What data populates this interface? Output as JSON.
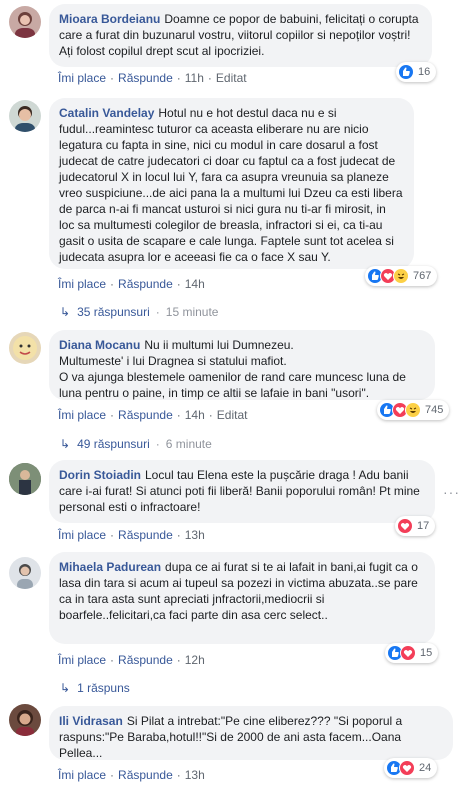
{
  "actions": {
    "like": "Îmi place",
    "reply": "Răspunde",
    "edited": "Editat",
    "dot": "·"
  },
  "comments": [
    {
      "author": "Mioara Bordeianu",
      "text": "Doamne ce popor de babuini, felicitați o corupta care a furat din buzunarul vostru, viitorul copiilor si nepoților voștri! Ați folost copilul drept scut al ipocriziei.",
      "time": "11h",
      "reactions": "16",
      "reaction_types": [
        "like"
      ]
    },
    {
      "author": "Catalin Vandelay",
      "text": "Hotul nu e hot destul daca nu e si fudul...reamintesc tuturor ca aceasta eliberare nu are nicio legatura cu fapta in sine, nici cu modul in care dosarul a fost judecat de catre judecatori ci doar cu faptul ca a fost judecat de judecatorul X in locul lui Y, fara ca asupra vreunuia sa planeze vreo suspiciune...de aici pana la a multumi lui Dzeu ca esti libera de parca n-ai fi mancat usturoi si nici gura nu ti-ar fi mirosit, in loc sa multumesti colegilor de breasla, infractori si ei, ca ti-au gasit o usita de scapare e cale lunga. Faptele sunt tot acelea si judecata asupra lor e aceeasi fie ca o face X sau Y.",
      "time": "14h",
      "reactions": "767",
      "reaction_types": [
        "like",
        "heart",
        "haha"
      ],
      "replies": "35 răspunsuri",
      "replies_time": "15 minute"
    },
    {
      "author": "Diana Mocanu",
      "text": "Nu ii multumi lui Dumnezeu.\nMultumeste' i lui Dragnea si statului mafiot.\nO va ajunga blestemele oamenilor de rand care muncesc luna de luna pentru o paine, in timp ce altii se lafaie in bani \"usori\".",
      "time": "14h",
      "reactions": "745",
      "reaction_types": [
        "like",
        "heart",
        "haha"
      ],
      "replies": "49 răspunsuri",
      "replies_time": "6 minute"
    },
    {
      "author": "Dorin Stoiadin",
      "text": "Locul tau Elena este la pușcărie draga ! Adu banii care i-ai furat! Si atunci poti fii liberă! Banii poporului român! Pt mine personal esti o infractoare!",
      "time": "13h",
      "reactions": "17",
      "reaction_types": [
        "heart"
      ]
    },
    {
      "author": "Mihaela Padurean",
      "text": "dupa ce ai furat si te ai lafait in bani,ai fugit ca o lasa din tara si acum ai tupeul sa pozezi in victima abuzata..se pare ca in tara asta sunt apreciati jnfractorii,mediocrii si boarfele..felicitari,ca faci parte din asa cerc select..",
      "time": "12h",
      "reactions": "15",
      "reaction_types": [
        "like",
        "heart"
      ],
      "replies": "1 răspuns"
    },
    {
      "author": "Ili Vidrasan",
      "text": "Si Pilat a intrebat:\"Pe cine eliberez??? \"Si poporul a raspuns:\"Pe Baraba,hotul!!\"Si de 2000 de ani asta facem...Oana Pellea...",
      "time": "13h",
      "reactions": "24",
      "reaction_types": [
        "like",
        "heart"
      ]
    }
  ],
  "colors": {
    "link": "#385898",
    "bubble": "#f2f3f5",
    "muted": "#606770"
  }
}
